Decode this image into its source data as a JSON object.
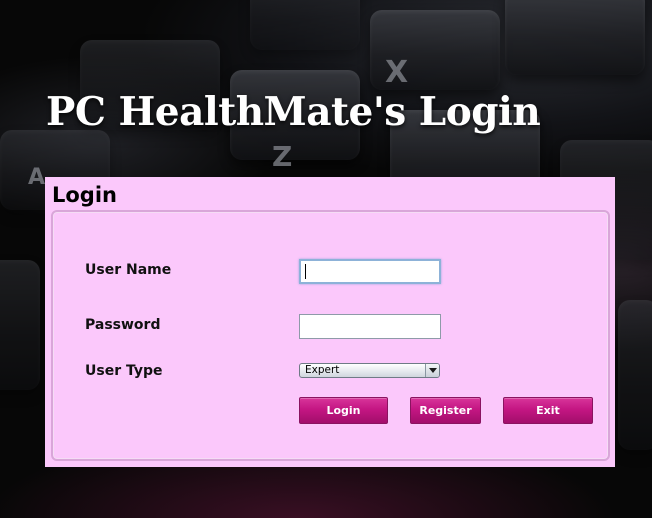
{
  "app": {
    "title": "PC HealthMate's Login"
  },
  "login_panel": {
    "title": "Login",
    "fields": {
      "username": {
        "label": "User Name",
        "value": "",
        "placeholder": ""
      },
      "password": {
        "label": "Password",
        "value": "",
        "placeholder": ""
      },
      "user_type": {
        "label": "User Type",
        "selected": "Expert"
      }
    },
    "buttons": {
      "login": "Login",
      "register": "Register",
      "exit": "Exit"
    }
  },
  "background": {
    "key_glyphs": [
      "X",
      "Z",
      "A"
    ]
  },
  "colors": {
    "panel_background": "#fbc8fb",
    "panel_border": "#d9a6d9",
    "button_magenta": "#c41683",
    "title_text": "#ffffff",
    "page_background": "#050505"
  }
}
